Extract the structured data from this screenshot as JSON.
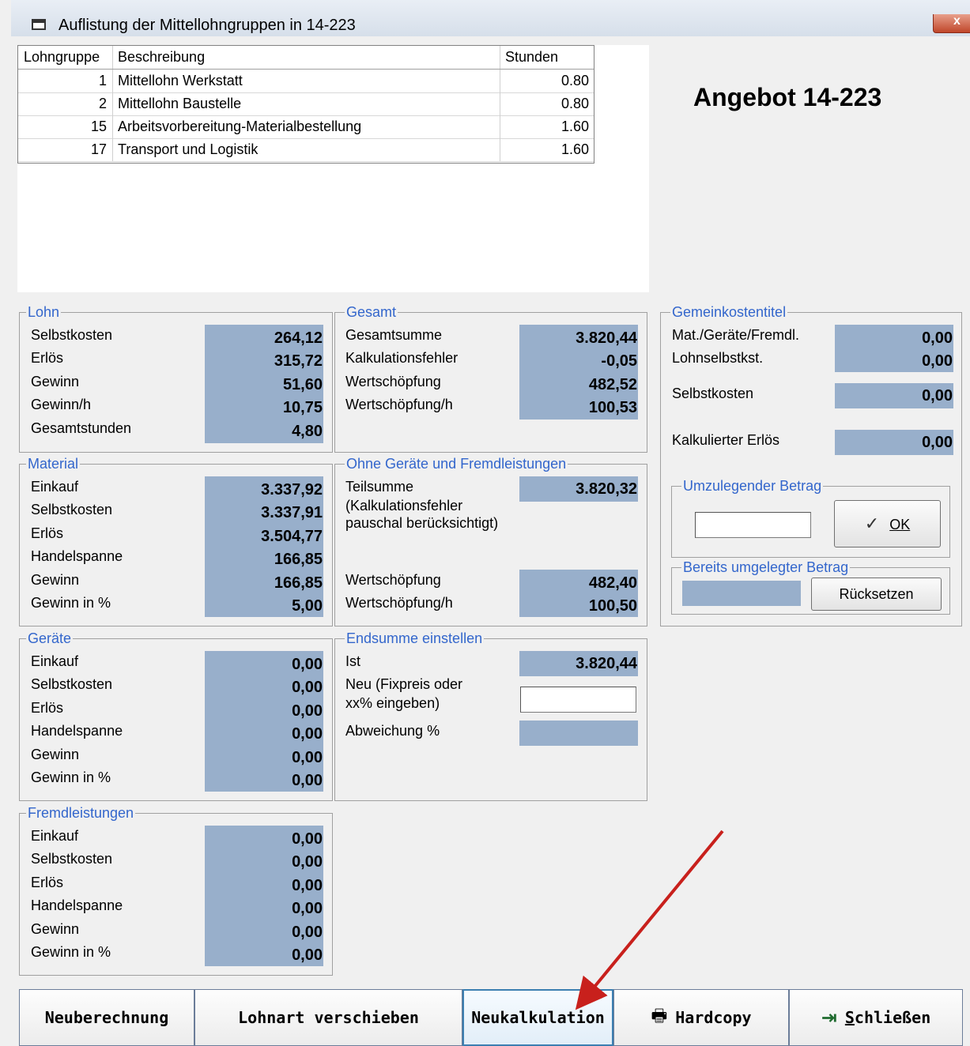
{
  "window": {
    "title": "Auflistung der Mittellohngruppen in 14-223",
    "close_glyph": "x"
  },
  "grid": {
    "headers": [
      "Lohngruppe",
      "Beschreibung",
      "Stunden"
    ],
    "rows": [
      {
        "group": "1",
        "desc": "Mittellohn Werkstatt",
        "hours": "0.80"
      },
      {
        "group": "2",
        "desc": "Mittellohn Baustelle",
        "hours": "0.80"
      },
      {
        "group": "15",
        "desc": "Arbeitsvorbereitung-Materialbestellung",
        "hours": "1.60"
      },
      {
        "group": "17",
        "desc": "Transport und Logistik",
        "hours": "1.60"
      }
    ]
  },
  "offer_title": "Angebot 14-223",
  "lohn": {
    "legend": "Lohn",
    "labels": [
      "Selbstkosten",
      "Erlös",
      "Gewinn",
      "Gewinn/h",
      "Gesamtstunden"
    ],
    "values": [
      "264,12",
      "315,72",
      "51,60",
      "10,75",
      "4,80"
    ]
  },
  "material": {
    "legend": "Material",
    "labels": [
      "Einkauf",
      "Selbstkosten",
      "Erlös",
      "Handelspanne",
      "Gewinn",
      "Gewinn in %"
    ],
    "values": [
      "3.337,92",
      "3.337,91",
      "3.504,77",
      "166,85",
      "166,85",
      "5,00"
    ]
  },
  "geraete": {
    "legend": "Geräte",
    "labels": [
      "Einkauf",
      "Selbstkosten",
      "Erlös",
      "Handelspanne",
      "Gewinn",
      "Gewinn in %"
    ],
    "values": [
      "0,00",
      "0,00",
      "0,00",
      "0,00",
      "0,00",
      "0,00"
    ]
  },
  "fremd": {
    "legend": "Fremdleistungen",
    "labels": [
      "Einkauf",
      "Selbstkosten",
      "Erlös",
      "Handelspanne",
      "Gewinn",
      "Gewinn in %"
    ],
    "values": [
      "0,00",
      "0,00",
      "0,00",
      "0,00",
      "0,00",
      "0,00"
    ]
  },
  "gesamt": {
    "legend": "Gesamt",
    "labels": [
      "Gesamtsumme",
      "Kalkulationsfehler",
      "Wertschöpfung",
      "Wertschöpfung/h"
    ],
    "values": [
      "3.820,44",
      "-0,05",
      "482,52",
      "100,53"
    ]
  },
  "ohne": {
    "legend": "Ohne Geräte und Fremdleistungen",
    "teilsumme_label": "Teilsumme",
    "teilsumme_note1": "(Kalkulationsfehler",
    "teilsumme_note2": "pauschal berücksichtigt)",
    "teilsumme_value": "3.820,32",
    "wert_label": "Wertschöpfung",
    "wert_value": "482,40",
    "werth_label": "Wertschöpfung/h",
    "werth_value": "100,50"
  },
  "endsumme": {
    "legend": "Endsumme einstellen",
    "ist_label": "Ist",
    "ist_value": "3.820,44",
    "neu_label1": "Neu (Fixpreis oder",
    "neu_label2": "xx% eingeben)",
    "neu_value": "",
    "abw_label": "Abweichung %",
    "abw_value": ""
  },
  "gemein": {
    "legend": "Gemeinkostentitel",
    "mat_label": "Mat./Geräte/Fremdl.",
    "mat_value": "0,00",
    "lohn_label": "Lohnselbstkst.",
    "lohn_value": "0,00",
    "selbst_label": "Selbstkosten",
    "selbst_value": "0,00",
    "erloes_label": "Kalkulierter Erlös",
    "erloes_value": "0,00",
    "umzu_legend": "Umzulegender Betrag",
    "umzu_value": "",
    "ok_label": "OK",
    "ok_icon": "✓",
    "bereits_legend": "Bereits umgelegter Betrag",
    "bereits_value": "",
    "reset_label": "Rücksetzen"
  },
  "buttons": {
    "neuberechnung": "Neuberechnung",
    "lohnart": "Lohnart verschieben",
    "neukalkulation": "Neukalkulation",
    "hardcopy": "Hardcopy",
    "hardcopy_icon": "🖶",
    "schliessen_first": "S",
    "schliessen_rest": "chließen",
    "schliessen_icon": "⇥"
  },
  "colors": {
    "value_bg": "#98afcb",
    "legend": "#3366cc",
    "arrow": "#c8201c"
  }
}
